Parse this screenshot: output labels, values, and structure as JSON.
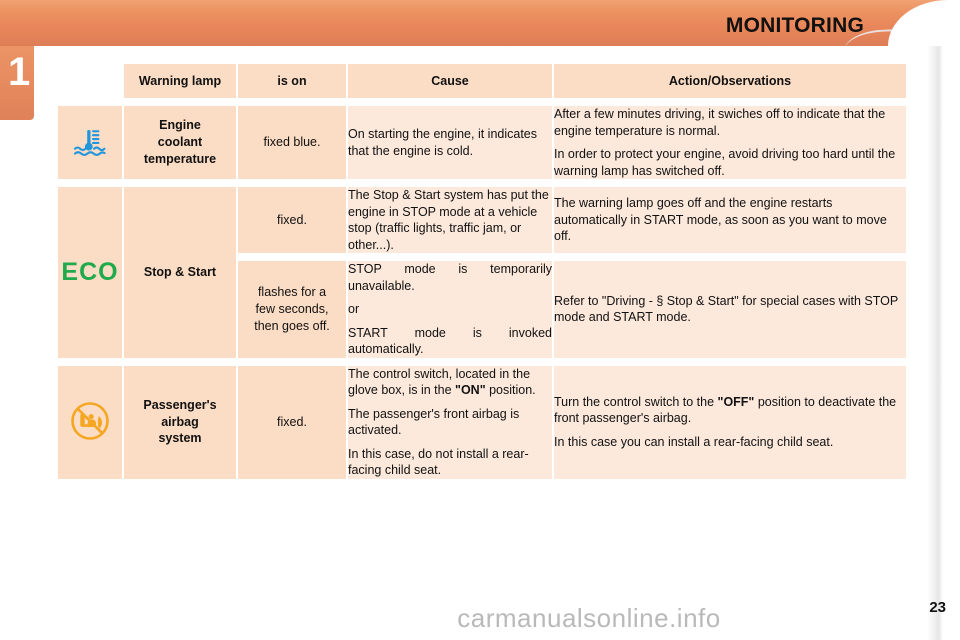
{
  "header": {
    "title": "MONITORING",
    "chapter_number": "1"
  },
  "table": {
    "columns": [
      {
        "key": "warning_lamp",
        "label": "Warning lamp"
      },
      {
        "key": "is_on",
        "label": "is on"
      },
      {
        "key": "cause",
        "label": "Cause"
      },
      {
        "key": "action",
        "label": "Action/Observations"
      }
    ],
    "rows": [
      {
        "icon": "coolant-temperature-icon",
        "icon_color": "#2196dd",
        "lamp": "Engine\ncoolant\ntemperature",
        "lamp_lines": [
          "Engine",
          "coolant",
          "temperature"
        ],
        "is_on": "fixed blue.",
        "cause_paragraphs": [
          "On starting the engine, it indicates that the engine is cold."
        ],
        "action_paragraphs": [
          "After a few minutes driving, it swiches off to indicate that the engine temperature is normal.",
          "In order to protect your engine, avoid driving too hard until the warning lamp has switched off."
        ]
      },
      {
        "icon": "eco-logo-icon",
        "icon_color": "#1faa4b",
        "icon_text": "ECO",
        "lamp_lines": [
          "Stop & Start"
        ],
        "is_on": "fixed.",
        "cause_paragraphs": [
          "The Stop & Start system has put the engine in STOP mode at a vehicle stop (traffic lights, traffic jam, or other...)."
        ],
        "action_paragraphs": [
          "The warning lamp goes off and the engine restarts automatically in START mode, as soon as you want to move off."
        ]
      },
      {
        "icon": "",
        "lamp_lines": [],
        "is_on_lines": [
          "flashes for a",
          "few seconds,",
          "then goes off."
        ],
        "cause_paragraphs": [
          "STOP mode is temporarily unavailable.",
          "or",
          "START mode is invoked automatically."
        ],
        "action_paragraphs": [
          "Refer to \"Driving - § Stop & Start\" for special cases with STOP mode and START mode."
        ]
      },
      {
        "icon": "no-rear-facing-child-seat-icon",
        "icon_color": "#f5a623",
        "lamp_lines": [
          "Passenger's",
          "airbag",
          "system"
        ],
        "is_on": "fixed.",
        "cause_html_parts": [
          {
            "text": "The control switch, located in the glove box, is in the ",
            "bold": false
          },
          {
            "text": "\"ON\"",
            "bold": true
          },
          {
            "text": " position.",
            "bold": false
          }
        ],
        "cause_paragraphs": [
          "The passenger's front airbag is activated.",
          "In this case, do not install a rear-facing child seat."
        ],
        "action_html_parts": [
          {
            "text": "Turn the control switch to the ",
            "bold": false
          },
          {
            "text": "\"OFF\"",
            "bold": true
          },
          {
            "text": " position to deactivate the front passenger's airbag.",
            "bold": false
          }
        ],
        "action_paragraphs": [
          "In this case you can install a rear-facing child seat."
        ]
      }
    ]
  },
  "footer": {
    "page_number": "23",
    "watermark": "carmanualsonline.info"
  },
  "colors": {
    "banner_orange": "#e8855a",
    "header_cell": "#fbdcc4",
    "body_cell": "#fce9dc",
    "eco_green": "#1faa4b",
    "coolant_blue": "#2196dd",
    "airbag_amber": "#f5a623"
  }
}
